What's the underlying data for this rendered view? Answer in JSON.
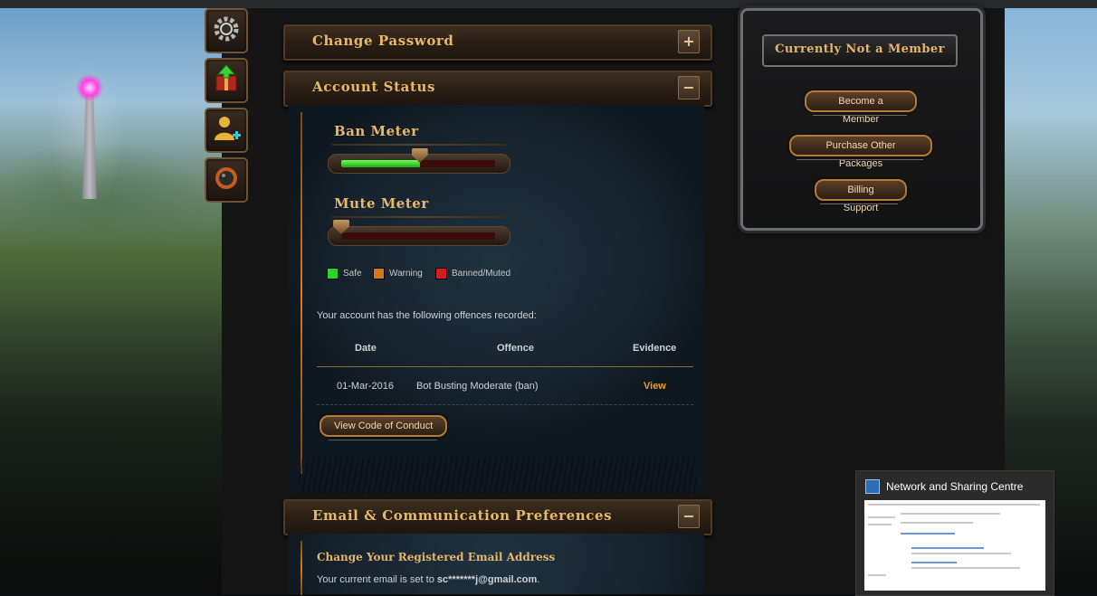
{
  "colors": {
    "accent_gold": "#e7b866",
    "link_orange": "#e3a33a",
    "safe": "#2fd42a",
    "warning": "#d1781c",
    "banned": "#d21d1d"
  },
  "left_icons": [
    {
      "icon": "gear-icon"
    },
    {
      "icon": "gift-box-icon"
    },
    {
      "icon": "add-friend-icon"
    },
    {
      "icon": "bomb-icon"
    }
  ],
  "panels": {
    "change_password": {
      "title": "Change Password",
      "toggle": "+"
    },
    "account_status": {
      "title": "Account Status",
      "toggle": "−"
    },
    "email_prefs": {
      "title": "Email & Communication Preferences",
      "toggle": "−"
    }
  },
  "account_status": {
    "ban_meter": {
      "label": "Ban Meter",
      "level": 0.51
    },
    "mute_meter": {
      "label": "Mute Meter",
      "level": 0.0
    },
    "legend": [
      {
        "label": "Safe",
        "color": "#2fd42a"
      },
      {
        "label": "Warning",
        "color": "#d1781c"
      },
      {
        "label": "Banned/Muted",
        "color": "#d21d1d"
      }
    ],
    "offences_intro": "Your account has the following offences recorded:",
    "table": {
      "headers": [
        "Date",
        "Offence",
        "Evidence"
      ],
      "rows": [
        {
          "date": "01-Mar-2016",
          "offence": "Bot Busting Moderate (ban)",
          "evidence": "View"
        }
      ]
    },
    "code_of_conduct_button": "View Code of Conduct"
  },
  "email_prefs": {
    "subtitle": "Change Your Registered Email Address",
    "current_email_prefix": "Your current email is set to ",
    "current_email": "sc*******j@gmail.com",
    "current_email_suffix": "."
  },
  "membership": {
    "title": "Currently Not a Member",
    "buttons": [
      "Become a Member",
      "Purchase Other Packages",
      "Billing Support"
    ]
  },
  "taskbar_preview": {
    "title": "Network and Sharing Centre",
    "icon": "network-icon"
  }
}
